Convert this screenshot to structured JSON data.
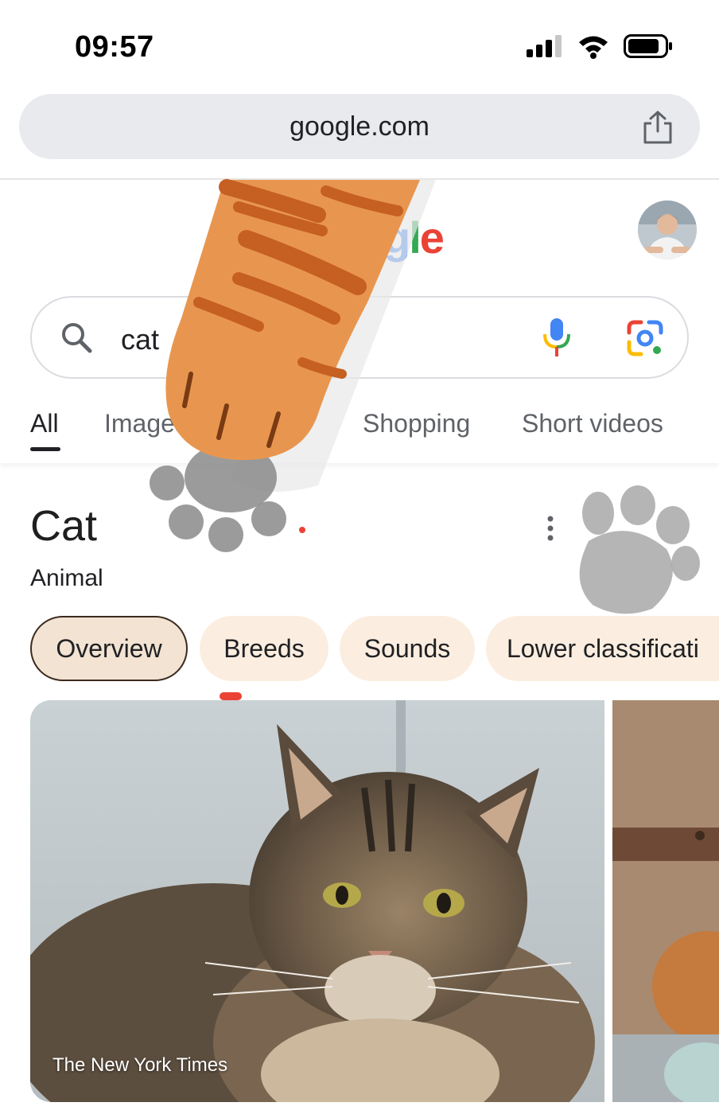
{
  "status_bar": {
    "time": "09:57"
  },
  "browser": {
    "url": "google.com",
    "share_icon": "share-icon"
  },
  "header": {
    "logo_visible_text": "gle",
    "avatar_icon": "avatar"
  },
  "search": {
    "query": "cat"
  },
  "tabs": [
    {
      "label": "All",
      "active": true
    },
    {
      "label": "Images",
      "active": false
    },
    {
      "label": "Shopping",
      "active": false
    },
    {
      "label": "Short videos",
      "active": false
    }
  ],
  "knowledge_panel": {
    "title": "Cat",
    "subtitle": "Animal",
    "chips": [
      "Overview",
      "Breeds",
      "Sounds",
      "Lower classificati"
    ],
    "selected_chip": "Overview"
  },
  "images": [
    {
      "source": "The New York Times"
    }
  ],
  "colors": {
    "google_blue": "#4285F4",
    "google_red": "#EA4335",
    "google_yellow": "#FBBC05",
    "google_green": "#34A853",
    "chip_bg": "#fbeee0",
    "paw_orange": "#e8964f"
  }
}
